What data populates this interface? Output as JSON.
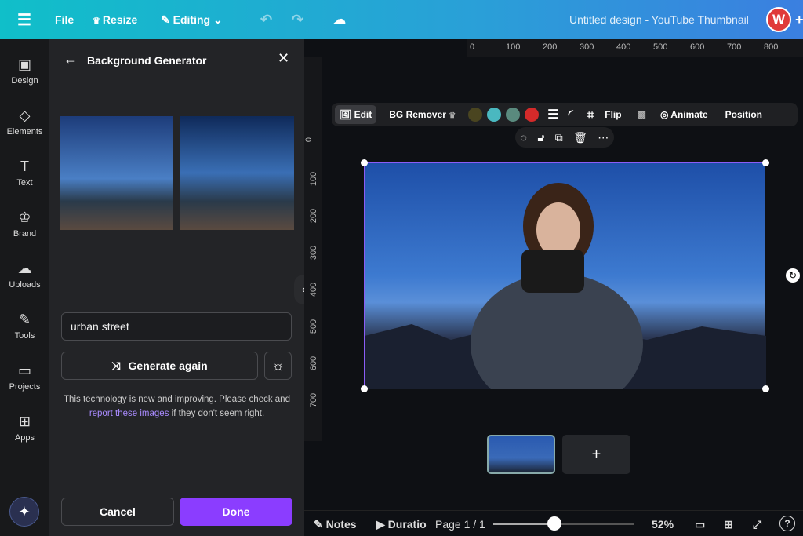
{
  "topbar": {
    "file": "File",
    "resize": "Resize",
    "editing": "Editing",
    "title": "Untitled design - YouTube Thumbnail",
    "avatar": "W"
  },
  "sidebar": {
    "items": [
      {
        "label": "Design",
        "icon": "▣"
      },
      {
        "label": "Elements",
        "icon": "◇"
      },
      {
        "label": "Text",
        "icon": "T"
      },
      {
        "label": "Brand",
        "icon": "♔"
      },
      {
        "label": "Uploads",
        "icon": "☁"
      },
      {
        "label": "Tools",
        "icon": "✎"
      },
      {
        "label": "Projects",
        "icon": "▭"
      },
      {
        "label": "Apps",
        "icon": "⊞"
      }
    ]
  },
  "panel": {
    "title": "Background Generator",
    "prompt": "urban street",
    "generate": "Generate again",
    "notice": "This technology is new and improving. Please check and",
    "link": "report these images",
    "notice_end": " if they don't seem right.",
    "cancel": "Cancel",
    "done": "Done"
  },
  "toolbar": {
    "edit": "Edit",
    "bg_remover": "BG Remover",
    "colors": [
      "#4a4520",
      "#4ab8c0",
      "#5a8a7e",
      "#d42a2a"
    ],
    "flip": "Flip",
    "animate": "Animate",
    "position": "Position"
  },
  "ruler": {
    "top": [
      "0",
      "100",
      "200",
      "300",
      "400",
      "500",
      "600",
      "700",
      "800"
    ],
    "left": [
      "0",
      "100",
      "200",
      "300",
      "400",
      "500",
      "600",
      "700"
    ]
  },
  "bottom": {
    "notes": "Notes",
    "duration": "Duratio",
    "page": "Page 1 / 1",
    "zoom": "52%",
    "zoom_value": 52
  },
  "accent": "#8b3dff"
}
